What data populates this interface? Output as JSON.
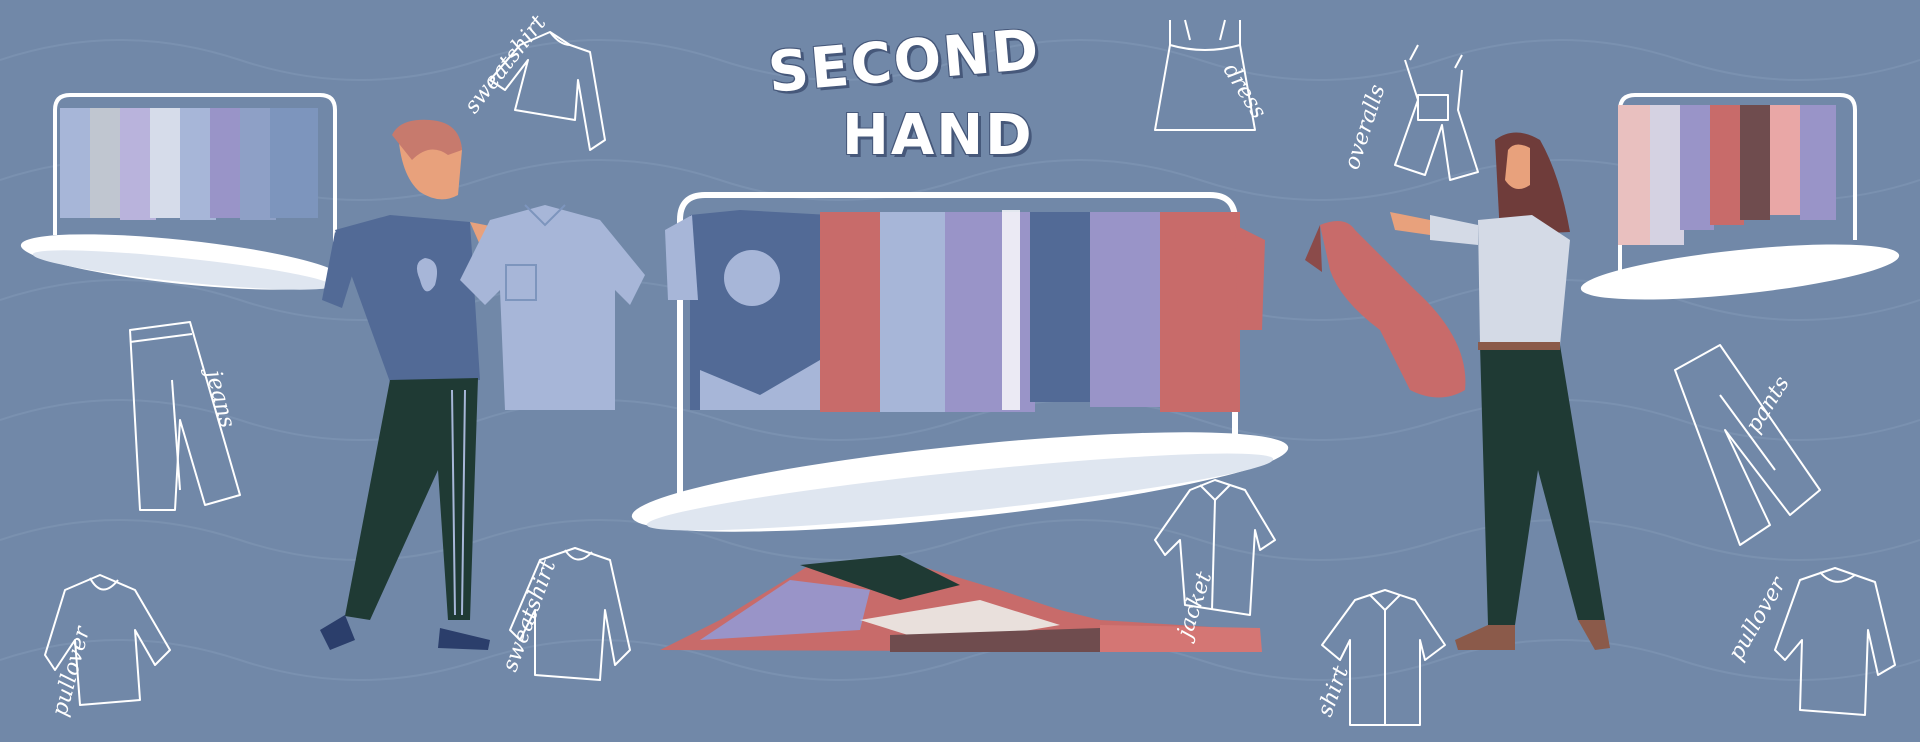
{
  "title": {
    "line1": "SECOND",
    "line2": "HAND"
  },
  "labels": {
    "sweatshirt_top": "sweatshirt",
    "dress": "dress",
    "overalls": "overalls",
    "jeans": "jeans",
    "pants": "pants",
    "pullover_left": "pullover",
    "sweatshirt_bottom": "sweatshirt",
    "jacket": "jacket",
    "shirt": "shirt",
    "pullover_right": "pullover"
  },
  "colors": {
    "background": "#7188a8",
    "outline": "#ffffff",
    "navy": "#526a96",
    "coral": "#c86b6a",
    "lavender": "#9994c8",
    "light_blue": "#a7b6d8",
    "dark_green": "#1f3a34"
  },
  "icons": {
    "sweatshirt": "sweatshirt-icon",
    "dress": "dress-icon",
    "overalls": "overalls-icon",
    "jeans": "jeans-icon",
    "pants": "pants-icon",
    "pullover": "pullover-icon",
    "jacket": "jacket-icon",
    "shirt": "shirt-icon"
  }
}
